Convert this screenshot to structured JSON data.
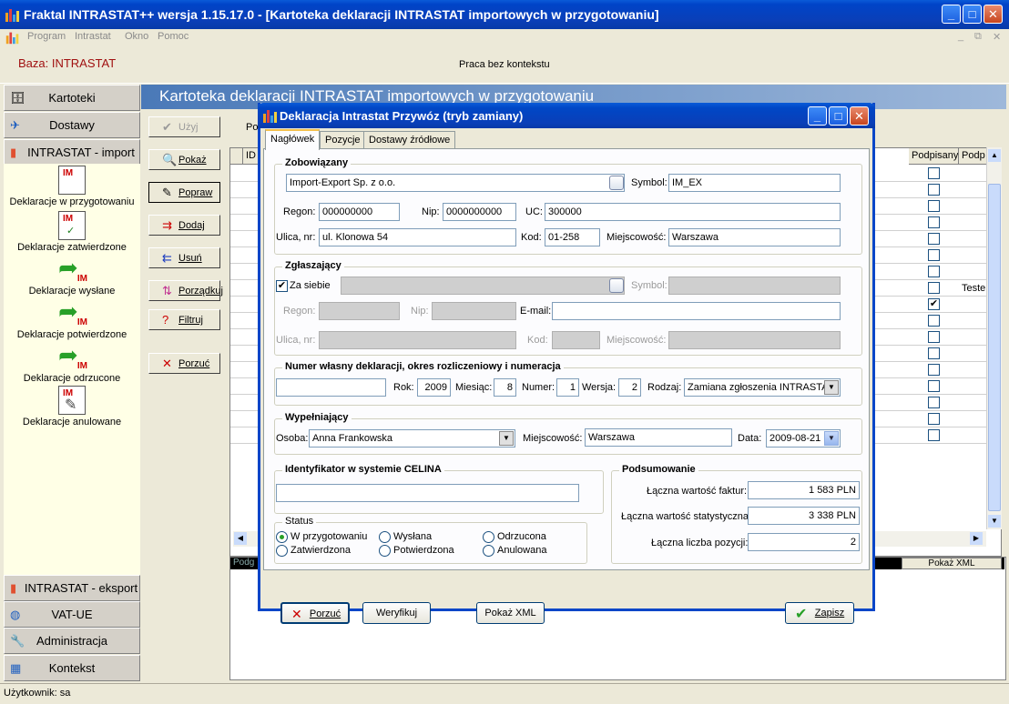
{
  "app": {
    "title": "Fraktal INTRASTAT++  wersja 1.15.17.0 - [Kartoteka deklaracji INTRASTAT importowych w przygotowaniu]",
    "menu": [
      "Program",
      "Intrastat",
      "Okno",
      "Pomoc"
    ],
    "baza_label": "Baza: INTRASTAT",
    "context_text": "Praca bez kontekstu",
    "status_user": "Użytkownik: sa"
  },
  "nav": {
    "top_buttons": [
      "Kartoteki",
      "Dostawy",
      "INTRASTAT - import"
    ],
    "items": [
      "Deklaracje w przygotowaniu",
      "Deklaracje zatwierdzone",
      "Deklaracje wysłane",
      "Deklaracje potwierdzone",
      "Deklaracje odrzucone",
      "Deklaracje anulowane"
    ],
    "bottom_buttons": [
      "INTRASTAT - eksport",
      "VAT-UE",
      "Administracja",
      "Kontekst"
    ]
  },
  "toolbar": {
    "uzyj": "Użyj",
    "pokaz": "Pokaż",
    "popraw": "Popraw",
    "dodaj": "Dodaj",
    "usun": "Usuń",
    "porzadkuj": "Porządkuj",
    "filtruj": "Filtruj",
    "porzuc": "Porzuć"
  },
  "list": {
    "header": "Kartoteka deklaracji INTRASTAT importowych w przygotowaniu",
    "partial_label": "Po",
    "columns": {
      "id": "ID",
      "podpisany": "Podpisany",
      "podp_trunc": "Podp"
    },
    "checked_row_value": "Teste",
    "bottom_tab": "Podg",
    "pokaz_xml": "Pokaż XML"
  },
  "dialog": {
    "title": "Deklaracja Intrastat  Przywóz (tryb zamiany)",
    "tabs": [
      "Nagłówek",
      "Pozycje",
      "Dostawy źródłowe"
    ],
    "zobowiazany": {
      "title": "Zobowiązany",
      "name": "Import-Export Sp. z o.o.",
      "symbol_label": "Symbol:",
      "symbol": "IM_EX",
      "regon_label": "Regon:",
      "regon": "000000000",
      "nip_label": "Nip:",
      "nip": "0000000000",
      "uc_label": "UC:",
      "uc": "300000",
      "ulica_label": "Ulica, nr:",
      "ulica": "ul. Klonowa 54",
      "kod_label": "Kod:",
      "kod": "01-258",
      "miejscowosc_label": "Miejscowość:",
      "miejscowosc": "Warszawa"
    },
    "zglaszajacy": {
      "title": "Zgłaszający",
      "za_siebie": "Za siebie",
      "symbol_label": "Symbol:",
      "regon_label": "Regon:",
      "nip_label": "Nip:",
      "email_label": "E-mail:",
      "ulica_label": "Ulica, nr:",
      "kod_label": "Kod:",
      "miejscowosc_label": "Miejscowość:"
    },
    "numer": {
      "title": "Numer własny deklaracji, okres rozliczeniowy i numeracja",
      "rok_label": "Rok:",
      "rok": "2009",
      "miesiac_label": "Miesiąc:",
      "miesiac": "8",
      "numer_label": "Numer:",
      "numer": "1",
      "wersja_label": "Wersja:",
      "wersja": "2",
      "rodzaj_label": "Rodzaj:",
      "rodzaj": "Zamiana zgłoszenia INTRASTAT"
    },
    "wypelniajacy": {
      "title": "Wypełniający",
      "osoba_label": "Osoba:",
      "osoba": "Anna Frankowska",
      "miejscowosc_label": "Miejscowość:",
      "miejscowosc": "Warszawa",
      "data_label": "Data:",
      "data": "2009-08-21"
    },
    "celina": {
      "title": "Identyfikator w systemie CELINA"
    },
    "status": {
      "title": "Status",
      "options": [
        "W przygotowaniu",
        "Wysłana",
        "Odrzucona",
        "Zatwierdzona",
        "Potwierdzona",
        "Anulowana"
      ],
      "selected": "W przygotowaniu"
    },
    "podsumowanie": {
      "title": "Podsumowanie",
      "faktur_label": "Łączna wartość faktur:",
      "faktur": "1 583 PLN",
      "stat_label": "Łączna wartość statystyczna",
      "stat": "3 338 PLN",
      "pozycji_label": "Łączna liczba pozycji:",
      "pozycji": "2"
    },
    "buttons": {
      "porzuc": "Porzuć",
      "weryfikuj": "Weryfikuj",
      "pokaz_xml": "Pokaż XML",
      "zapisz": "Zapisz"
    }
  },
  "colors": {
    "xp_blue": "#0a46c8",
    "nav_panel": "#ffffe6",
    "list_header": "#4a79b8"
  }
}
